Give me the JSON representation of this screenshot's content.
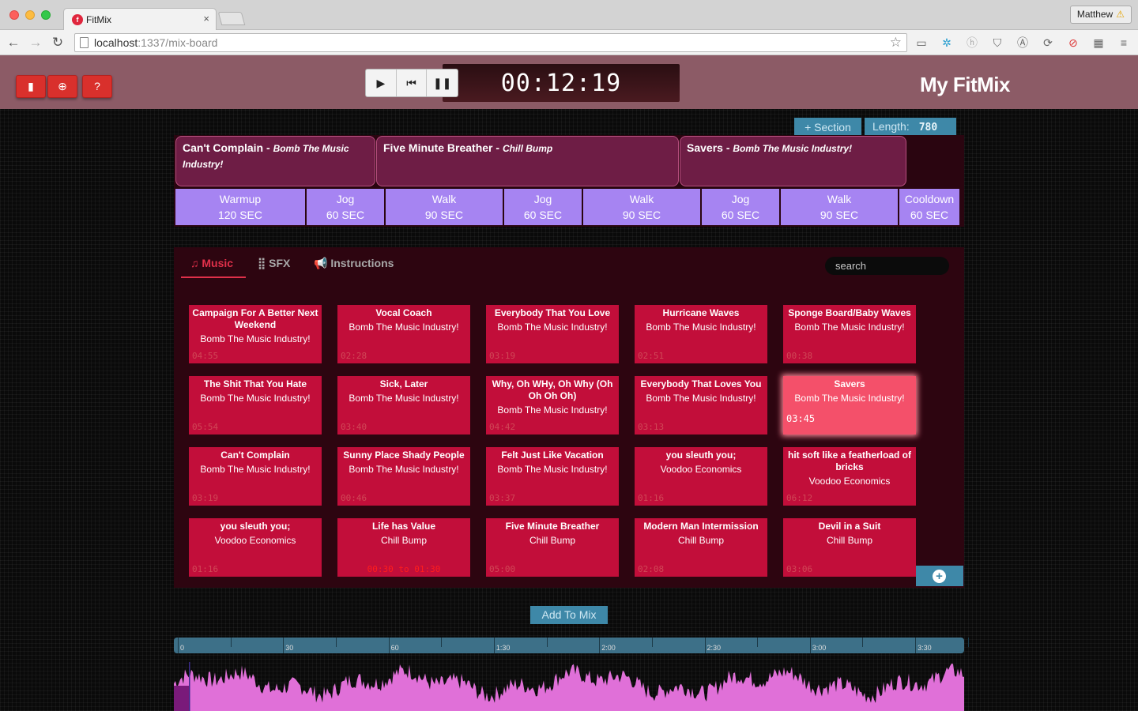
{
  "browser": {
    "tab_title": "FitMix",
    "tab_close": "×",
    "profile_name": "Matthew",
    "profile_warning": "⚠",
    "url_host": "localhost",
    "url_rest": ":1337/mix-board"
  },
  "header": {
    "timer": "00:12:19",
    "brand": "My FitMix"
  },
  "mix": {
    "add_section_label": "+ Section",
    "length_label": "Length:",
    "length_value": "780",
    "songs": [
      {
        "title": "Can't Complain",
        "sep": " - ",
        "artist": "Bomb The Music Industry!"
      },
      {
        "title": "Five Minute Breather",
        "sep": " - ",
        "artist": "Chill Bump"
      },
      {
        "title": "Savers",
        "sep": " - ",
        "artist": "Bomb The Music Industry!"
      }
    ],
    "segments": [
      {
        "name": "Warmup",
        "duration": "120 SEC"
      },
      {
        "name": "Jog",
        "duration": "60 SEC"
      },
      {
        "name": "Walk",
        "duration": "90 SEC"
      },
      {
        "name": "Jog",
        "duration": "60 SEC"
      },
      {
        "name": "Walk",
        "duration": "90 SEC"
      },
      {
        "name": "Jog",
        "duration": "60 SEC"
      },
      {
        "name": "Walk",
        "duration": "90 SEC"
      },
      {
        "name": "Cooldown",
        "duration": "60 SEC"
      }
    ]
  },
  "library": {
    "tabs": [
      {
        "label": "Music",
        "icon": "music-note-icon"
      },
      {
        "label": "SFX",
        "icon": "equalizer-icon"
      },
      {
        "label": "Instructions",
        "icon": "megaphone-icon"
      }
    ],
    "search_placeholder": "search",
    "tracks": [
      {
        "title": "Campaign For A Better Next Weekend",
        "artist": "Bomb The Music Industry!",
        "duration": "04:55"
      },
      {
        "title": "Vocal Coach",
        "artist": "Bomb The Music Industry!",
        "duration": "02:28"
      },
      {
        "title": "Everybody That You Love",
        "artist": "Bomb The Music Industry!",
        "duration": "03:19"
      },
      {
        "title": "Hurricane Waves",
        "artist": "Bomb The Music Industry!",
        "duration": "02:51"
      },
      {
        "title": "Sponge Board/Baby Waves",
        "artist": "Bomb The Music Industry!",
        "duration": "00:38"
      },
      {
        "title": "The Shit That You Hate",
        "artist": "Bomb The Music Industry!",
        "duration": "05:54"
      },
      {
        "title": "Sick, Later",
        "artist": "Bomb The Music Industry!",
        "duration": "03:40"
      },
      {
        "title": "Why, Oh WHy, Oh Why (Oh Oh Oh Oh)",
        "artist": "Bomb The Music Industry!",
        "duration": "04:42"
      },
      {
        "title": "Everybody That Loves You",
        "artist": "Bomb The Music Industry!",
        "duration": "03:13"
      },
      {
        "title": "Savers",
        "artist": "Bomb The Music Industry!",
        "duration": "03:45"
      },
      {
        "title": "Can't Complain",
        "artist": "Bomb The Music Industry!",
        "duration": "03:19"
      },
      {
        "title": "Sunny Place Shady People",
        "artist": "Bomb The Music Industry!",
        "duration": "00:46"
      },
      {
        "title": "Felt Just Like Vacation",
        "artist": "Bomb The Music Industry!",
        "duration": "03:37"
      },
      {
        "title": "you sleuth you;",
        "artist": "Voodoo Economics",
        "duration": "01:16"
      },
      {
        "title": "hit soft like a featherload of bricks",
        "artist": "Voodoo Economics",
        "duration": "06:12"
      },
      {
        "title": "you sleuth you;",
        "artist": "Voodoo Economics",
        "duration": "01:16"
      },
      {
        "title": "Life has Value",
        "artist": "Chill Bump",
        "duration": "00:30 to 01:30"
      },
      {
        "title": "Five Minute Breather",
        "artist": "Chill Bump",
        "duration": "05:00"
      },
      {
        "title": "Modern Man Intermission",
        "artist": "Chill Bump",
        "duration": "02:08"
      },
      {
        "title": "Devil in a Suit",
        "artist": "Chill Bump",
        "duration": "03:06"
      }
    ],
    "selected_track": 9,
    "add_to_mix_label": "Add To Mix"
  },
  "timeline": {
    "tick_labels": [
      "0",
      "30",
      "60",
      "1:30",
      "2:00",
      "2:30",
      "3:00",
      "3:30"
    ],
    "playhead_fraction": 0.019,
    "colors": {
      "waveform": "#e070d8",
      "played": "#7a1a7a"
    }
  }
}
